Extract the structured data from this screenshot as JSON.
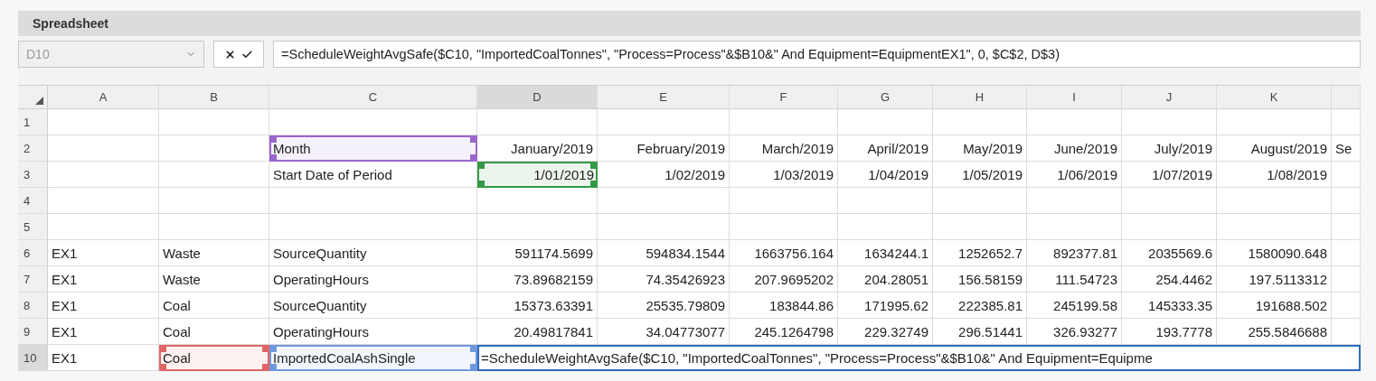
{
  "panel": {
    "title": "Spreadsheet"
  },
  "formula_bar": {
    "name_box": "D10",
    "formula": "=ScheduleWeightAvgSafe($C10, \"ImportedCoalTonnes\", \"Process=Process\"&$B10&\" And Equipment=EquipmentEX1\", 0, $C$2, D$3)"
  },
  "columns": [
    {
      "label": "A",
      "selected": false
    },
    {
      "label": "B",
      "selected": false
    },
    {
      "label": "C",
      "selected": false
    },
    {
      "label": "D",
      "selected": true
    },
    {
      "label": "E",
      "selected": false
    },
    {
      "label": "F",
      "selected": false
    },
    {
      "label": "G",
      "selected": false
    },
    {
      "label": "H",
      "selected": false
    },
    {
      "label": "I",
      "selected": false
    },
    {
      "label": "J",
      "selected": false
    },
    {
      "label": "K",
      "selected": false
    }
  ],
  "rows": [
    {
      "number": "1",
      "selected": false,
      "cells": [
        null,
        null,
        null,
        null,
        null,
        null,
        null,
        null,
        null,
        null,
        null,
        null
      ]
    },
    {
      "number": "2",
      "selected": false,
      "cells": [
        null,
        null,
        {
          "text": "Month",
          "kind": "text",
          "color": "#9966cc"
        },
        {
          "text": "January/2019",
          "kind": "number"
        },
        {
          "text": "February/2019",
          "kind": "number"
        },
        {
          "text": "March/2019",
          "kind": "number"
        },
        {
          "text": "April/2019",
          "kind": "number"
        },
        {
          "text": "May/2019",
          "kind": "number"
        },
        {
          "text": "June/2019",
          "kind": "number"
        },
        {
          "text": "July/2019",
          "kind": "number"
        },
        {
          "text": "August/2019",
          "kind": "number"
        },
        {
          "text": "Se",
          "kind": "text"
        }
      ]
    },
    {
      "number": "3",
      "selected": false,
      "cells": [
        null,
        null,
        {
          "text": "Start Date of Period",
          "kind": "text"
        },
        {
          "text": "1/01/2019",
          "kind": "number",
          "color": "#339944"
        },
        {
          "text": "1/02/2019",
          "kind": "number"
        },
        {
          "text": "1/03/2019",
          "kind": "number"
        },
        {
          "text": "1/04/2019",
          "kind": "number"
        },
        {
          "text": "1/05/2019",
          "kind": "number"
        },
        {
          "text": "1/06/2019",
          "kind": "number"
        },
        {
          "text": "1/07/2019",
          "kind": "number"
        },
        {
          "text": "1/08/2019",
          "kind": "number"
        },
        null
      ]
    },
    {
      "number": "4",
      "selected": false,
      "cells": [
        null,
        null,
        null,
        null,
        null,
        null,
        null,
        null,
        null,
        null,
        null,
        null
      ]
    },
    {
      "number": "5",
      "selected": false,
      "cells": [
        null,
        null,
        null,
        null,
        null,
        null,
        null,
        null,
        null,
        null,
        null,
        null
      ]
    },
    {
      "number": "6",
      "selected": false,
      "cells": [
        {
          "text": "EX1",
          "kind": "text"
        },
        {
          "text": "Waste",
          "kind": "text"
        },
        {
          "text": "SourceQuantity",
          "kind": "text"
        },
        {
          "text": "591174.5699",
          "kind": "number"
        },
        {
          "text": "594834.1544",
          "kind": "number"
        },
        {
          "text": "1663756.164",
          "kind": "number"
        },
        {
          "text": "1634244.1",
          "kind": "number"
        },
        {
          "text": "1252652.7",
          "kind": "number"
        },
        {
          "text": "892377.81",
          "kind": "number"
        },
        {
          "text": "2035569.6",
          "kind": "number"
        },
        {
          "text": "1580090.648",
          "kind": "number"
        },
        null
      ]
    },
    {
      "number": "7",
      "selected": false,
      "cells": [
        {
          "text": "EX1",
          "kind": "text"
        },
        {
          "text": "Waste",
          "kind": "text"
        },
        {
          "text": "OperatingHours",
          "kind": "text"
        },
        {
          "text": "73.89682159",
          "kind": "number"
        },
        {
          "text": "74.35426923",
          "kind": "number"
        },
        {
          "text": "207.9695202",
          "kind": "number"
        },
        {
          "text": "204.28051",
          "kind": "number"
        },
        {
          "text": "156.58159",
          "kind": "number"
        },
        {
          "text": "111.54723",
          "kind": "number"
        },
        {
          "text": "254.4462",
          "kind": "number"
        },
        {
          "text": "197.5113312",
          "kind": "number"
        },
        null
      ]
    },
    {
      "number": "8",
      "selected": false,
      "cells": [
        {
          "text": "EX1",
          "kind": "text"
        },
        {
          "text": "Coal",
          "kind": "text"
        },
        {
          "text": "SourceQuantity",
          "kind": "text"
        },
        {
          "text": "15373.63391",
          "kind": "number"
        },
        {
          "text": "25535.79809",
          "kind": "number"
        },
        {
          "text": "183844.86",
          "kind": "number"
        },
        {
          "text": "171995.62",
          "kind": "number"
        },
        {
          "text": "222385.81",
          "kind": "number"
        },
        {
          "text": "245199.58",
          "kind": "number"
        },
        {
          "text": "145333.35",
          "kind": "number"
        },
        {
          "text": "191688.502",
          "kind": "number"
        },
        null
      ]
    },
    {
      "number": "9",
      "selected": false,
      "cells": [
        {
          "text": "EX1",
          "kind": "text"
        },
        {
          "text": "Coal",
          "kind": "text"
        },
        {
          "text": "OperatingHours",
          "kind": "text"
        },
        {
          "text": "20.49817841",
          "kind": "number"
        },
        {
          "text": "34.04773077",
          "kind": "number"
        },
        {
          "text": "245.1264798",
          "kind": "number"
        },
        {
          "text": "229.32749",
          "kind": "number"
        },
        {
          "text": "296.51441",
          "kind": "number"
        },
        {
          "text": "326.93277",
          "kind": "number"
        },
        {
          "text": "193.7778",
          "kind": "number"
        },
        {
          "text": "255.5846688",
          "kind": "number"
        },
        null
      ]
    },
    {
      "number": "10",
      "selected": true,
      "cells": [
        {
          "text": "EX1",
          "kind": "text"
        },
        {
          "text": "Coal",
          "kind": "text",
          "color": "#e06666"
        },
        {
          "text": "ImportedCoalAshSingle",
          "kind": "text",
          "color": "#7099dd"
        },
        {
          "text": "=ScheduleWeightAvgSafe($C10, \"ImportedCoalTonnes\", \"Process=Process\"&$B10&\" And Equipment=Equipme",
          "kind": "formula",
          "color": "#2e6bbf"
        }
      ]
    }
  ]
}
